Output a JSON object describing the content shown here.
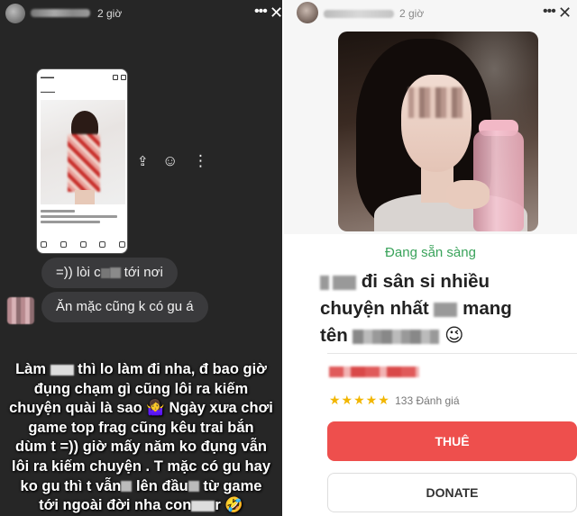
{
  "left_story": {
    "time": "2 giờ",
    "bubble_1": {
      "before": "=)) lòi c",
      "after": " tới nơi"
    },
    "bubble_2": "Ăn mặc cũng k có gu á",
    "caption": {
      "line1_a": "Làm ",
      "line1_b": " thì lo làm đi nha, đ bao giờ",
      "line2": "đụng chạm gì cũng lôi ra kiếm",
      "line3": "chuyện quài là sao 🤷‍♀️ Ngày xưa chơi",
      "line4": "game top frag cũng kêu trai bắn",
      "line5": "dùm t =)) giờ mấy năm ko đụng vẫn",
      "line6": "lôi ra kiếm chuyện . T mặc có gu hay",
      "line7_a": "ko gu thì t vẫn",
      "line7_b": " lên đầu",
      "line7_c": " từ game",
      "line8_a": "tới ngoài đời nha con",
      "line8_b": "r 🤣"
    }
  },
  "right_story": {
    "time": "2 giờ",
    "status": "Đang sẵn sàng",
    "headline": {
      "line1": " đi sân si nhiều",
      "line2_a": "chuyện nhất ",
      "line2_b": " mang",
      "line3_a": "tên ",
      "line3_b": " 😉"
    },
    "rating": {
      "stars": "★★★★★",
      "count_text": "133 Đánh giá",
      "value": 4.5
    },
    "hire_label": "THUÊ",
    "donate_label": "DONATE"
  },
  "colors": {
    "left_bg": "#262626",
    "bubble_bg": "#3a3a3c",
    "status_green": "#3aa35b",
    "hire_red": "#ee4f4d",
    "star_gold": "#f2b600"
  },
  "icons": [
    "share-icon",
    "emoji-icon",
    "more-vertical-icon",
    "more-horizontal-icon",
    "close-icon"
  ]
}
